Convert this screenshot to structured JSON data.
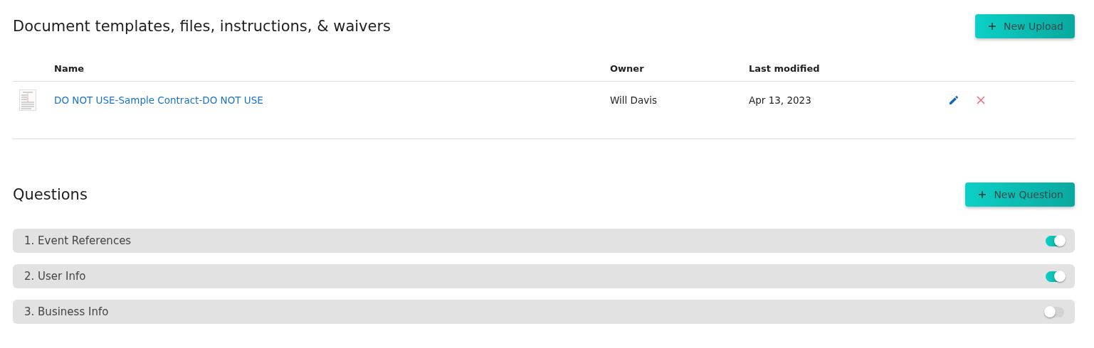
{
  "documents": {
    "title": "Document templates, files, instructions, & waivers",
    "new_button": "New Upload",
    "columns": [
      "Name",
      "Owner",
      "Last modified"
    ],
    "rows": [
      {
        "name": "DO NOT USE-Sample Contract-DO NOT USE",
        "owner": "Will Davis",
        "modified": "Apr 13, 2023"
      }
    ]
  },
  "questions": {
    "title": "Questions",
    "new_button": "New Question",
    "items": [
      {
        "label": "1. Event References",
        "on": true
      },
      {
        "label": "2. User Info",
        "on": true
      },
      {
        "label": "3. Business Info",
        "on": false
      }
    ]
  }
}
